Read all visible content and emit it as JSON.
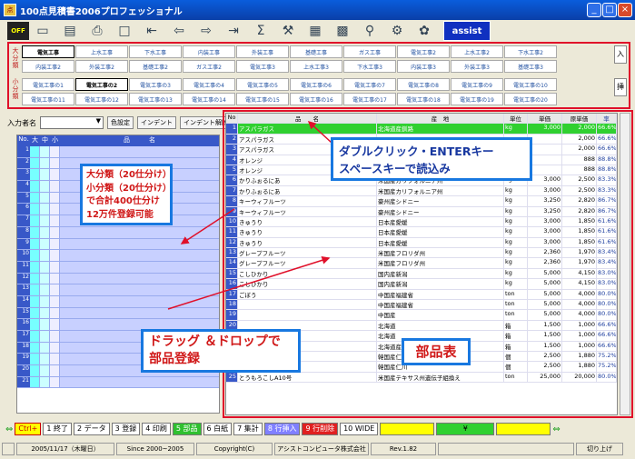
{
  "window": {
    "title": "100点見積書2006プロフェッショナル"
  },
  "toolbar": {
    "off_label": "OFF",
    "assist_label": "assist"
  },
  "categories": {
    "major_label": "大分類",
    "minor_label": "小分類",
    "enter_label": "入",
    "ins_label": "挿",
    "major_rows": [
      [
        "電気工事",
        "上水工事",
        "下水工事",
        "内装工事",
        "外装工事",
        "基礎工事",
        "ガス工事",
        "電気工事2",
        "上水工事2",
        "下水工事2"
      ],
      [
        "内装工事2",
        "外装工事2",
        "基礎工事2",
        "ガス工事2",
        "電気工事3",
        "上水工事3",
        "下水工事3",
        "内装工事3",
        "外装工事3",
        "基礎工事3"
      ]
    ],
    "minor_rows": [
      [
        "電気工事の1",
        "電気工事の2",
        "電気工事の3",
        "電気工事の4",
        "電気工事の5",
        "電気工事の6",
        "電気工事の7",
        "電気工事の8",
        "電気工事の9",
        "電気工事の10"
      ],
      [
        "電気工事の11",
        "電気工事の12",
        "電気工事の13",
        "電気工事の14",
        "電気工事の15",
        "電気工事の16",
        "電気工事の17",
        "電気工事の18",
        "電気工事の19",
        "電気工事の20"
      ]
    ]
  },
  "input": {
    "label": "入力者名",
    "select_arrow": "▼",
    "color_btn": "色設定",
    "indent_btn": "インデント",
    "indent_btn2": "インデント解除"
  },
  "left_grid": {
    "headers": [
      "No.",
      "大",
      "中",
      "小",
      "品　　　名"
    ],
    "rows": [
      "1",
      "2",
      "3",
      "4",
      "5",
      "6",
      "7",
      "8",
      "9",
      "10",
      "11",
      "12",
      "13",
      "14",
      "15",
      "16",
      "17",
      "18",
      "19",
      "20",
      "21"
    ]
  },
  "parts": {
    "headers": [
      "No",
      "品　　名",
      "産　地",
      "単位",
      "単価",
      "原単価",
      "率"
    ],
    "rows": [
      [
        "1",
        "アスパラガス",
        "北海道産釧路",
        "kg",
        "3,000",
        "2,000",
        "66.6%"
      ],
      [
        "2",
        "アスパラガス",
        "",
        "",
        "",
        "2,000",
        "66.6%"
      ],
      [
        "3",
        "アスパラガス",
        "",
        "",
        "",
        "2,000",
        "66.6%"
      ],
      [
        "4",
        "オレンジ",
        "",
        "",
        "",
        "888",
        "88.8%"
      ],
      [
        "5",
        "オレンジ",
        "",
        "",
        "",
        "888",
        "88.8%"
      ],
      [
        "6",
        "かりふぉるにあ",
        "米国産カリフォルニア州",
        "kg",
        "3,000",
        "2,500",
        "83.3%"
      ],
      [
        "7",
        "かりふぉるにあ",
        "米国産カリフォルニア州",
        "kg",
        "3,000",
        "2,500",
        "83.3%"
      ],
      [
        "8",
        "キーウィフルーツ",
        "豪州産シドニー",
        "kg",
        "3,250",
        "2,820",
        "86.7%"
      ],
      [
        "9",
        "キーウィフルーツ",
        "豪州産シドニー",
        "kg",
        "3,250",
        "2,820",
        "86.7%"
      ],
      [
        "10",
        "きゅうり",
        "日本産愛媛",
        "kg",
        "3,000",
        "1,850",
        "61.6%"
      ],
      [
        "11",
        "きゅうり",
        "日本産愛媛",
        "kg",
        "3,000",
        "1,850",
        "61.6%"
      ],
      [
        "12",
        "きゅうり",
        "日本産愛媛",
        "kg",
        "3,000",
        "1,850",
        "61.6%"
      ],
      [
        "13",
        "グレープフルーツ",
        "米国産フロリダ州",
        "kg",
        "2,360",
        "1,970",
        "83.4%"
      ],
      [
        "14",
        "グレープフルーツ",
        "米国産フロリダ州",
        "kg",
        "2,360",
        "1,970",
        "83.4%"
      ],
      [
        "15",
        "こしひかり",
        "国内産新潟",
        "kg",
        "5,000",
        "4,150",
        "83.0%"
      ],
      [
        "16",
        "こしひかり",
        "国内産新潟",
        "kg",
        "5,000",
        "4,150",
        "83.0%"
      ],
      [
        "17",
        "ごぼう",
        "中国産福建省",
        "ton",
        "5,000",
        "4,000",
        "80.0%"
      ],
      [
        "18",
        "",
        "中国産福建省",
        "ton",
        "5,000",
        "4,000",
        "80.0%"
      ],
      [
        "19",
        "",
        "中国産",
        "ton",
        "5,000",
        "4,000",
        "80.0%"
      ],
      [
        "20",
        "",
        "北海道",
        "箱",
        "1,500",
        "1,000",
        "66.6%"
      ],
      [
        "21",
        "",
        "北海道",
        "箱",
        "1,500",
        "1,000",
        "66.6%"
      ],
      [
        "22",
        "",
        "北海道産日高",
        "箱",
        "1,500",
        "1,000",
        "66.6%"
      ],
      [
        "23",
        "すいか",
        "韓国産仁川",
        "個",
        "2,500",
        "1,880",
        "75.2%"
      ],
      [
        "24",
        "すいか",
        "韓国産仁川",
        "個",
        "2,500",
        "1,880",
        "75.2%"
      ],
      [
        "25",
        "とうもろこしA10号",
        "米国産テキサス州遺伝子組換え",
        "ton",
        "25,000",
        "20,000",
        "80.0%"
      ]
    ]
  },
  "callouts": {
    "read": "ダブルクリック・ENTERキー\nスペースキーで読込み",
    "classes": "大分類（20仕分け）\n小分類（20仕分け）\nで合計400仕分け\n12万件登録可能",
    "drag": "ドラッグ ＆ドロップで\n部品登録",
    "parts": "部品表"
  },
  "fkeys": [
    "Ctrl+",
    "1 終了",
    "2 データ",
    "3 登録",
    "4 印刷",
    "5 部品",
    "6 白紙",
    "7 集計",
    "8 行挿入",
    "9 行削除",
    "10 WIDE",
    "",
    "¥",
    ""
  ],
  "status": [
    "",
    "2005/11/17（木曜日）",
    "Since 2000~2005",
    "Copyright(C)",
    "アシストコンピュータ株式会社",
    "Rev.1.82",
    "",
    "切り上げ"
  ]
}
